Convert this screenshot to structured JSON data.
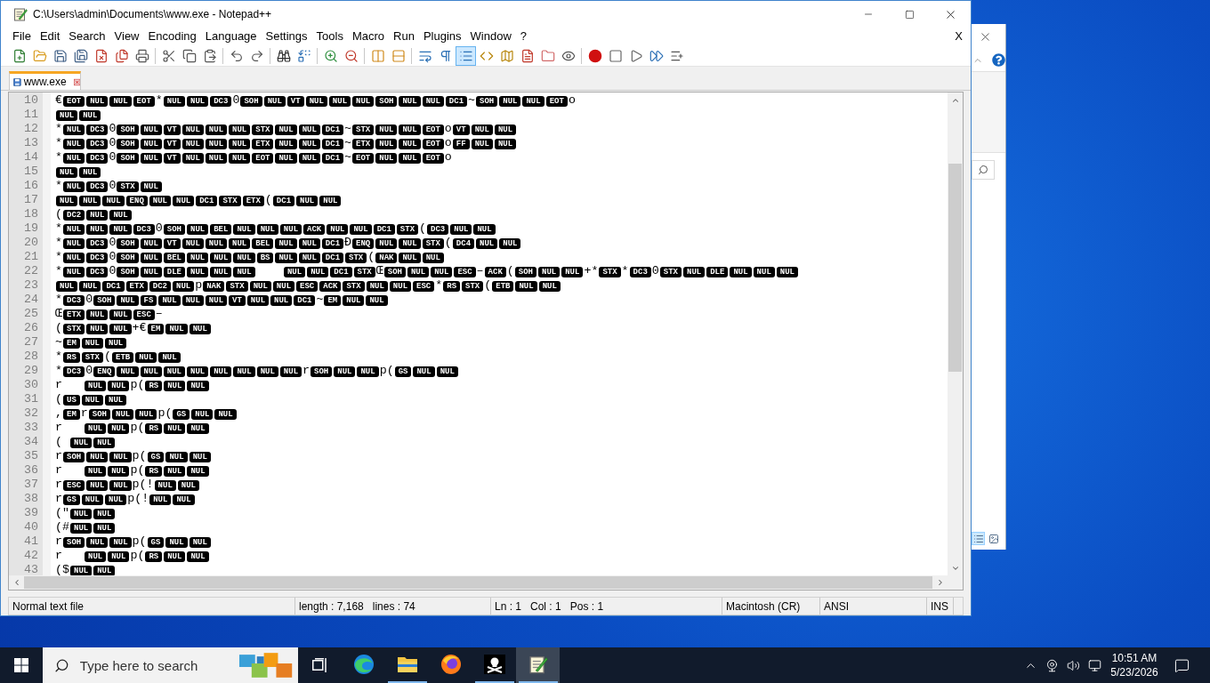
{
  "window": {
    "title": "C:\\Users\\admin\\Documents\\www.exe - Notepad++"
  },
  "menu": {
    "items": [
      "File",
      "Edit",
      "Search",
      "View",
      "Encoding",
      "Language",
      "Settings",
      "Tools",
      "Macro",
      "Run",
      "Plugins",
      "Window",
      "?"
    ],
    "close_label": "X"
  },
  "toolbar": [
    {
      "buttons": [
        {
          "on": false
        },
        {
          "on": false
        },
        {
          "on": false
        },
        {
          "on": false
        },
        {
          "on": false
        },
        {
          "on": false
        },
        {
          "on": false
        }
      ]
    },
    {
      "buttons": [
        {
          "on": false
        },
        {
          "on": false
        },
        {
          "on": false
        }
      ]
    },
    {
      "buttons": [
        {
          "on": false
        },
        {
          "on": false
        }
      ]
    },
    {
      "buttons": [
        {
          "on": false
        },
        {
          "on": false
        }
      ]
    },
    {
      "buttons": [
        {
          "on": false
        },
        {
          "on": false
        }
      ]
    },
    {
      "buttons": [
        {
          "on": false
        },
        {
          "on": false
        }
      ]
    },
    {
      "buttons": [
        {
          "on": false
        },
        {
          "on": false
        },
        {
          "on": true
        },
        {
          "on": false
        },
        {
          "on": false
        },
        {
          "on": false
        },
        {
          "on": false
        },
        {
          "on": false
        }
      ]
    },
    {
      "buttons": [
        {
          "on": false
        },
        {
          "on": false
        },
        {
          "on": false
        },
        {
          "on": false
        },
        {
          "on": false
        }
      ]
    }
  ],
  "tabs": [
    {
      "label": "www.exe",
      "selected": true
    }
  ],
  "editor": {
    "lines": [
      {
        "number": "10",
        "tokens": [
          {
            "kind": "text",
            "text": "€"
          },
          {
            "kind": "ctrl",
            "text": "EOT"
          },
          {
            "kind": "ctrl",
            "text": "NUL"
          },
          {
            "kind": "ctrl",
            "text": "NUL"
          },
          {
            "kind": "ctrl",
            "text": "EOT"
          },
          {
            "kind": "text",
            "text": "*"
          },
          {
            "kind": "ctrl",
            "text": "NUL"
          },
          {
            "kind": "ctrl",
            "text": "NUL"
          },
          {
            "kind": "ctrl",
            "text": "DC3"
          },
          {
            "kind": "text",
            "text": "0"
          },
          {
            "kind": "ctrl",
            "text": "SOH"
          },
          {
            "kind": "ctrl",
            "text": "NUL"
          },
          {
            "kind": "ctrl",
            "text": "VT"
          },
          {
            "kind": "ctrl",
            "text": "NUL"
          },
          {
            "kind": "ctrl",
            "text": "NUL"
          },
          {
            "kind": "ctrl",
            "text": "NUL"
          },
          {
            "kind": "ctrl",
            "text": "SOH"
          },
          {
            "kind": "ctrl",
            "text": "NUL"
          },
          {
            "kind": "ctrl",
            "text": "NUL"
          },
          {
            "kind": "ctrl",
            "text": "DC1"
          },
          {
            "kind": "text",
            "text": "~"
          },
          {
            "kind": "ctrl",
            "text": "SOH"
          },
          {
            "kind": "ctrl",
            "text": "NUL"
          },
          {
            "kind": "ctrl",
            "text": "NUL"
          },
          {
            "kind": "ctrl",
            "text": "EOT"
          },
          {
            "kind": "text",
            "text": "o"
          }
        ]
      },
      {
        "number": "11",
        "tokens": [
          {
            "kind": "ctrl",
            "text": "NUL"
          },
          {
            "kind": "ctrl",
            "text": "NUL"
          }
        ]
      },
      {
        "number": "12",
        "tokens": [
          {
            "kind": "text",
            "text": "*"
          },
          {
            "kind": "ctrl",
            "text": "NUL"
          },
          {
            "kind": "ctrl",
            "text": "DC3"
          },
          {
            "kind": "text",
            "text": "0"
          },
          {
            "kind": "ctrl",
            "text": "SOH"
          },
          {
            "kind": "ctrl",
            "text": "NUL"
          },
          {
            "kind": "ctrl",
            "text": "VT"
          },
          {
            "kind": "ctrl",
            "text": "NUL"
          },
          {
            "kind": "ctrl",
            "text": "NUL"
          },
          {
            "kind": "ctrl",
            "text": "NUL"
          },
          {
            "kind": "ctrl",
            "text": "STX"
          },
          {
            "kind": "ctrl",
            "text": "NUL"
          },
          {
            "kind": "ctrl",
            "text": "NUL"
          },
          {
            "kind": "ctrl",
            "text": "DC1"
          },
          {
            "kind": "text",
            "text": "~"
          },
          {
            "kind": "ctrl",
            "text": "STX"
          },
          {
            "kind": "ctrl",
            "text": "NUL"
          },
          {
            "kind": "ctrl",
            "text": "NUL"
          },
          {
            "kind": "ctrl",
            "text": "EOT"
          },
          {
            "kind": "text",
            "text": "o"
          },
          {
            "kind": "ctrl",
            "text": "VT"
          },
          {
            "kind": "ctrl",
            "text": "NUL"
          },
          {
            "kind": "ctrl",
            "text": "NUL"
          }
        ]
      },
      {
        "number": "13",
        "tokens": [
          {
            "kind": "text",
            "text": "*"
          },
          {
            "kind": "ctrl",
            "text": "NUL"
          },
          {
            "kind": "ctrl",
            "text": "DC3"
          },
          {
            "kind": "text",
            "text": "0"
          },
          {
            "kind": "ctrl",
            "text": "SOH"
          },
          {
            "kind": "ctrl",
            "text": "NUL"
          },
          {
            "kind": "ctrl",
            "text": "VT"
          },
          {
            "kind": "ctrl",
            "text": "NUL"
          },
          {
            "kind": "ctrl",
            "text": "NUL"
          },
          {
            "kind": "ctrl",
            "text": "NUL"
          },
          {
            "kind": "ctrl",
            "text": "ETX"
          },
          {
            "kind": "ctrl",
            "text": "NUL"
          },
          {
            "kind": "ctrl",
            "text": "NUL"
          },
          {
            "kind": "ctrl",
            "text": "DC1"
          },
          {
            "kind": "text",
            "text": "~"
          },
          {
            "kind": "ctrl",
            "text": "ETX"
          },
          {
            "kind": "ctrl",
            "text": "NUL"
          },
          {
            "kind": "ctrl",
            "text": "NUL"
          },
          {
            "kind": "ctrl",
            "text": "EOT"
          },
          {
            "kind": "text",
            "text": "o"
          },
          {
            "kind": "ctrl",
            "text": "FF"
          },
          {
            "kind": "ctrl",
            "text": "NUL"
          },
          {
            "kind": "ctrl",
            "text": "NUL"
          }
        ]
      },
      {
        "number": "14",
        "tokens": [
          {
            "kind": "text",
            "text": "*"
          },
          {
            "kind": "ctrl",
            "text": "NUL"
          },
          {
            "kind": "ctrl",
            "text": "DC3"
          },
          {
            "kind": "text",
            "text": "0"
          },
          {
            "kind": "ctrl",
            "text": "SOH"
          },
          {
            "kind": "ctrl",
            "text": "NUL"
          },
          {
            "kind": "ctrl",
            "text": "VT"
          },
          {
            "kind": "ctrl",
            "text": "NUL"
          },
          {
            "kind": "ctrl",
            "text": "NUL"
          },
          {
            "kind": "ctrl",
            "text": "NUL"
          },
          {
            "kind": "ctrl",
            "text": "EOT"
          },
          {
            "kind": "ctrl",
            "text": "NUL"
          },
          {
            "kind": "ctrl",
            "text": "NUL"
          },
          {
            "kind": "ctrl",
            "text": "DC1"
          },
          {
            "kind": "text",
            "text": "~"
          },
          {
            "kind": "ctrl",
            "text": "EOT"
          },
          {
            "kind": "ctrl",
            "text": "NUL"
          },
          {
            "kind": "ctrl",
            "text": "NUL"
          },
          {
            "kind": "ctrl",
            "text": "EOT"
          },
          {
            "kind": "text",
            "text": "o"
          }
        ]
      },
      {
        "number": "15",
        "tokens": [
          {
            "kind": "ctrl",
            "text": "NUL"
          },
          {
            "kind": "ctrl",
            "text": "NUL"
          }
        ]
      },
      {
        "number": "16",
        "tokens": [
          {
            "kind": "text",
            "text": "*"
          },
          {
            "kind": "ctrl",
            "text": "NUL"
          },
          {
            "kind": "ctrl",
            "text": "DC3"
          },
          {
            "kind": "text",
            "text": "0"
          },
          {
            "kind": "ctrl",
            "text": "STX"
          },
          {
            "kind": "ctrl",
            "text": "NUL"
          }
        ]
      },
      {
        "number": "17",
        "tokens": [
          {
            "kind": "ctrl",
            "text": "NUL"
          },
          {
            "kind": "ctrl",
            "text": "NUL"
          },
          {
            "kind": "ctrl",
            "text": "NUL"
          },
          {
            "kind": "ctrl",
            "text": "ENQ"
          },
          {
            "kind": "ctrl",
            "text": "NUL"
          },
          {
            "kind": "ctrl",
            "text": "NUL"
          },
          {
            "kind": "ctrl",
            "text": "DC1"
          },
          {
            "kind": "ctrl",
            "text": "STX"
          },
          {
            "kind": "ctrl",
            "text": "ETX"
          },
          {
            "kind": "text",
            "text": "("
          },
          {
            "kind": "ctrl",
            "text": "DC1"
          },
          {
            "kind": "ctrl",
            "text": "NUL"
          },
          {
            "kind": "ctrl",
            "text": "NUL"
          }
        ]
      },
      {
        "number": "18",
        "tokens": [
          {
            "kind": "text",
            "text": "("
          },
          {
            "kind": "ctrl",
            "text": "DC2"
          },
          {
            "kind": "ctrl",
            "text": "NUL"
          },
          {
            "kind": "ctrl",
            "text": "NUL"
          }
        ]
      },
      {
        "number": "19",
        "tokens": [
          {
            "kind": "text",
            "text": "*"
          },
          {
            "kind": "ctrl",
            "text": "NUL"
          },
          {
            "kind": "ctrl",
            "text": "NUL"
          },
          {
            "kind": "ctrl",
            "text": "NUL"
          },
          {
            "kind": "ctrl",
            "text": "DC3"
          },
          {
            "kind": "text",
            "text": "0"
          },
          {
            "kind": "ctrl",
            "text": "SOH"
          },
          {
            "kind": "ctrl",
            "text": "NUL"
          },
          {
            "kind": "ctrl",
            "text": "BEL"
          },
          {
            "kind": "ctrl",
            "text": "NUL"
          },
          {
            "kind": "ctrl",
            "text": "NUL"
          },
          {
            "kind": "ctrl",
            "text": "NUL"
          },
          {
            "kind": "ctrl",
            "text": "ACK"
          },
          {
            "kind": "ctrl",
            "text": "NUL"
          },
          {
            "kind": "ctrl",
            "text": "NUL"
          },
          {
            "kind": "ctrl",
            "text": "DC1"
          },
          {
            "kind": "ctrl",
            "text": "STX"
          },
          {
            "kind": "text",
            "text": "("
          },
          {
            "kind": "ctrl",
            "text": "DC3"
          },
          {
            "kind": "ctrl",
            "text": "NUL"
          },
          {
            "kind": "ctrl",
            "text": "NUL"
          }
        ]
      },
      {
        "number": "20",
        "tokens": [
          {
            "kind": "text",
            "text": "*"
          },
          {
            "kind": "ctrl",
            "text": "NUL"
          },
          {
            "kind": "ctrl",
            "text": "DC3"
          },
          {
            "kind": "text",
            "text": "0"
          },
          {
            "kind": "ctrl",
            "text": "SOH"
          },
          {
            "kind": "ctrl",
            "text": "NUL"
          },
          {
            "kind": "ctrl",
            "text": "VT"
          },
          {
            "kind": "ctrl",
            "text": "NUL"
          },
          {
            "kind": "ctrl",
            "text": "NUL"
          },
          {
            "kind": "ctrl",
            "text": "NUL"
          },
          {
            "kind": "ctrl",
            "text": "BEL"
          },
          {
            "kind": "ctrl",
            "text": "NUL"
          },
          {
            "kind": "ctrl",
            "text": "NUL"
          },
          {
            "kind": "ctrl",
            "text": "DC1"
          },
          {
            "kind": "text",
            "text": "Ð"
          },
          {
            "kind": "ctrl",
            "text": "ENQ"
          },
          {
            "kind": "ctrl",
            "text": "NUL"
          },
          {
            "kind": "ctrl",
            "text": "NUL"
          },
          {
            "kind": "ctrl",
            "text": "STX"
          },
          {
            "kind": "text",
            "text": "("
          },
          {
            "kind": "ctrl",
            "text": "DC4"
          },
          {
            "kind": "ctrl",
            "text": "NUL"
          },
          {
            "kind": "ctrl",
            "text": "NUL"
          }
        ]
      },
      {
        "number": "21",
        "tokens": [
          {
            "kind": "text",
            "text": "*"
          },
          {
            "kind": "ctrl",
            "text": "NUL"
          },
          {
            "kind": "ctrl",
            "text": "DC3"
          },
          {
            "kind": "text",
            "text": "0"
          },
          {
            "kind": "ctrl",
            "text": "SOH"
          },
          {
            "kind": "ctrl",
            "text": "NUL"
          },
          {
            "kind": "ctrl",
            "text": "BEL"
          },
          {
            "kind": "ctrl",
            "text": "NUL"
          },
          {
            "kind": "ctrl",
            "text": "NUL"
          },
          {
            "kind": "ctrl",
            "text": "NUL"
          },
          {
            "kind": "ctrl",
            "text": "BS"
          },
          {
            "kind": "ctrl",
            "text": "NUL"
          },
          {
            "kind": "ctrl",
            "text": "NUL"
          },
          {
            "kind": "ctrl",
            "text": "DC1"
          },
          {
            "kind": "ctrl",
            "text": "STX"
          },
          {
            "kind": "text",
            "text": "("
          },
          {
            "kind": "ctrl",
            "text": "NAK"
          },
          {
            "kind": "ctrl",
            "text": "NUL"
          },
          {
            "kind": "ctrl",
            "text": "NUL"
          }
        ]
      },
      {
        "number": "22",
        "tokens": [
          {
            "kind": "text",
            "text": "*"
          },
          {
            "kind": "ctrl",
            "text": "NUL"
          },
          {
            "kind": "ctrl",
            "text": "DC3"
          },
          {
            "kind": "text",
            "text": "0"
          },
          {
            "kind": "ctrl",
            "text": "SOH"
          },
          {
            "kind": "ctrl",
            "text": "NUL"
          },
          {
            "kind": "ctrl",
            "text": "DLE"
          },
          {
            "kind": "ctrl",
            "text": "NUL"
          },
          {
            "kind": "ctrl",
            "text": "NUL"
          },
          {
            "kind": "ctrl",
            "text": "NUL"
          },
          {
            "kind": "tab"
          },
          {
            "kind": "ctrl",
            "text": "NUL"
          },
          {
            "kind": "ctrl",
            "text": "NUL"
          },
          {
            "kind": "ctrl",
            "text": "DC1"
          },
          {
            "kind": "ctrl",
            "text": "STX"
          },
          {
            "kind": "text",
            "text": "Œ"
          },
          {
            "kind": "ctrl",
            "text": "SOH"
          },
          {
            "kind": "ctrl",
            "text": "NUL"
          },
          {
            "kind": "ctrl",
            "text": "NUL"
          },
          {
            "kind": "ctrl",
            "text": "ESC"
          },
          {
            "kind": "text",
            "text": "–"
          },
          {
            "kind": "ctrl",
            "text": "ACK"
          },
          {
            "kind": "text",
            "text": "("
          },
          {
            "kind": "ctrl",
            "text": "SOH"
          },
          {
            "kind": "ctrl",
            "text": "NUL"
          },
          {
            "kind": "ctrl",
            "text": "NUL"
          },
          {
            "kind": "text",
            "text": "+*"
          },
          {
            "kind": "ctrl",
            "text": "STX"
          },
          {
            "kind": "text",
            "text": "*"
          },
          {
            "kind": "ctrl",
            "text": "DC3"
          },
          {
            "kind": "text",
            "text": "0"
          },
          {
            "kind": "ctrl",
            "text": "STX"
          },
          {
            "kind": "ctrl",
            "text": "NUL"
          },
          {
            "kind": "ctrl",
            "text": "DLE"
          },
          {
            "kind": "ctrl",
            "text": "NUL"
          },
          {
            "kind": "ctrl",
            "text": "NUL"
          },
          {
            "kind": "ctrl",
            "text": "NUL"
          }
        ]
      },
      {
        "number": "23",
        "tokens": [
          {
            "kind": "ctrl",
            "text": "NUL"
          },
          {
            "kind": "ctrl",
            "text": "NUL"
          },
          {
            "kind": "ctrl",
            "text": "DC1"
          },
          {
            "kind": "ctrl",
            "text": "ETX"
          },
          {
            "kind": "ctrl",
            "text": "DC2"
          },
          {
            "kind": "ctrl",
            "text": "NUL"
          },
          {
            "kind": "text",
            "text": "p"
          },
          {
            "kind": "ctrl",
            "text": "NAK"
          },
          {
            "kind": "ctrl",
            "text": "STX"
          },
          {
            "kind": "ctrl",
            "text": "NUL"
          },
          {
            "kind": "ctrl",
            "text": "NUL"
          },
          {
            "kind": "ctrl",
            "text": "ESC"
          },
          {
            "kind": "ctrl",
            "text": "ACK"
          },
          {
            "kind": "ctrl",
            "text": "STX"
          },
          {
            "kind": "ctrl",
            "text": "NUL"
          },
          {
            "kind": "ctrl",
            "text": "NUL"
          },
          {
            "kind": "ctrl",
            "text": "ESC"
          },
          {
            "kind": "text",
            "text": "*"
          },
          {
            "kind": "ctrl",
            "text": "RS"
          },
          {
            "kind": "ctrl",
            "text": "STX"
          },
          {
            "kind": "text",
            "text": "("
          },
          {
            "kind": "ctrl",
            "text": "ETB"
          },
          {
            "kind": "ctrl",
            "text": "NUL"
          },
          {
            "kind": "ctrl",
            "text": "NUL"
          }
        ]
      },
      {
        "number": "24",
        "tokens": [
          {
            "kind": "text",
            "text": "*"
          },
          {
            "kind": "ctrl",
            "text": "DC3"
          },
          {
            "kind": "text",
            "text": "0"
          },
          {
            "kind": "ctrl",
            "text": "SOH"
          },
          {
            "kind": "ctrl",
            "text": "NUL"
          },
          {
            "kind": "ctrl",
            "text": "FS"
          },
          {
            "kind": "ctrl",
            "text": "NUL"
          },
          {
            "kind": "ctrl",
            "text": "NUL"
          },
          {
            "kind": "ctrl",
            "text": "NUL"
          },
          {
            "kind": "ctrl",
            "text": "VT"
          },
          {
            "kind": "ctrl",
            "text": "NUL"
          },
          {
            "kind": "ctrl",
            "text": "NUL"
          },
          {
            "kind": "ctrl",
            "text": "DC1"
          },
          {
            "kind": "text",
            "text": "~"
          },
          {
            "kind": "ctrl",
            "text": "EM"
          },
          {
            "kind": "ctrl",
            "text": "NUL"
          },
          {
            "kind": "ctrl",
            "text": "NUL"
          }
        ]
      },
      {
        "number": "25",
        "tokens": [
          {
            "kind": "text",
            "text": "Œ"
          },
          {
            "kind": "ctrl",
            "text": "ETX"
          },
          {
            "kind": "ctrl",
            "text": "NUL"
          },
          {
            "kind": "ctrl",
            "text": "NUL"
          },
          {
            "kind": "ctrl",
            "text": "ESC"
          },
          {
            "kind": "text",
            "text": "–"
          }
        ]
      },
      {
        "number": "26",
        "tokens": [
          {
            "kind": "text",
            "text": "("
          },
          {
            "kind": "ctrl",
            "text": "STX"
          },
          {
            "kind": "ctrl",
            "text": "NUL"
          },
          {
            "kind": "ctrl",
            "text": "NUL"
          },
          {
            "kind": "text",
            "text": "+€"
          },
          {
            "kind": "ctrl",
            "text": "EM"
          },
          {
            "kind": "ctrl",
            "text": "NUL"
          },
          {
            "kind": "ctrl",
            "text": "NUL"
          }
        ]
      },
      {
        "number": "27",
        "tokens": [
          {
            "kind": "text",
            "text": "~"
          },
          {
            "kind": "ctrl",
            "text": "EM"
          },
          {
            "kind": "ctrl",
            "text": "NUL"
          },
          {
            "kind": "ctrl",
            "text": "NUL"
          }
        ]
      },
      {
        "number": "28",
        "tokens": [
          {
            "kind": "text",
            "text": "*"
          },
          {
            "kind": "ctrl",
            "text": "RS"
          },
          {
            "kind": "ctrl",
            "text": "STX"
          },
          {
            "kind": "text",
            "text": "("
          },
          {
            "kind": "ctrl",
            "text": "ETB"
          },
          {
            "kind": "ctrl",
            "text": "NUL"
          },
          {
            "kind": "ctrl",
            "text": "NUL"
          }
        ]
      },
      {
        "number": "29",
        "tokens": [
          {
            "kind": "text",
            "text": "*"
          },
          {
            "kind": "ctrl",
            "text": "DC3"
          },
          {
            "kind": "text",
            "text": "0"
          },
          {
            "kind": "ctrl",
            "text": "ENQ"
          },
          {
            "kind": "ctrl",
            "text": "NUL"
          },
          {
            "kind": "ctrl",
            "text": "NUL"
          },
          {
            "kind": "ctrl",
            "text": "NUL"
          },
          {
            "kind": "ctrl",
            "text": "NUL"
          },
          {
            "kind": "ctrl",
            "text": "NUL"
          },
          {
            "kind": "ctrl",
            "text": "NUL"
          },
          {
            "kind": "ctrl",
            "text": "NUL"
          },
          {
            "kind": "ctrl",
            "text": "NUL"
          },
          {
            "kind": "text",
            "text": "r"
          },
          {
            "kind": "ctrl",
            "text": "SOH"
          },
          {
            "kind": "ctrl",
            "text": "NUL"
          },
          {
            "kind": "ctrl",
            "text": "NUL"
          },
          {
            "kind": "text",
            "text": "p("
          },
          {
            "kind": "ctrl",
            "text": "GS"
          },
          {
            "kind": "ctrl",
            "text": "NUL"
          },
          {
            "kind": "ctrl",
            "text": "NUL"
          }
        ]
      },
      {
        "number": "30",
        "tokens": [
          {
            "kind": "text",
            "text": "r"
          },
          {
            "kind": "tab"
          },
          {
            "kind": "ctrl",
            "text": "NUL"
          },
          {
            "kind": "ctrl",
            "text": "NUL"
          },
          {
            "kind": "text",
            "text": "p("
          },
          {
            "kind": "ctrl",
            "text": "RS"
          },
          {
            "kind": "ctrl",
            "text": "NUL"
          },
          {
            "kind": "ctrl",
            "text": "NUL"
          }
        ]
      },
      {
        "number": "31",
        "tokens": [
          {
            "kind": "text",
            "text": "("
          },
          {
            "kind": "ctrl",
            "text": "US"
          },
          {
            "kind": "ctrl",
            "text": "NUL"
          },
          {
            "kind": "ctrl",
            "text": "NUL"
          }
        ]
      },
      {
        "number": "32",
        "tokens": [
          {
            "kind": "text",
            "text": ","
          },
          {
            "kind": "ctrl",
            "text": "EM"
          },
          {
            "kind": "text",
            "text": "r"
          },
          {
            "kind": "ctrl",
            "text": "SOH"
          },
          {
            "kind": "ctrl",
            "text": "NUL"
          },
          {
            "kind": "ctrl",
            "text": "NUL"
          },
          {
            "kind": "text",
            "text": "p("
          },
          {
            "kind": "ctrl",
            "text": "GS"
          },
          {
            "kind": "ctrl",
            "text": "NUL"
          },
          {
            "kind": "ctrl",
            "text": "NUL"
          }
        ]
      },
      {
        "number": "33",
        "tokens": [
          {
            "kind": "text",
            "text": "r"
          },
          {
            "kind": "tab"
          },
          {
            "kind": "ctrl",
            "text": "NUL"
          },
          {
            "kind": "ctrl",
            "text": "NUL"
          },
          {
            "kind": "text",
            "text": "p("
          },
          {
            "kind": "ctrl",
            "text": "RS"
          },
          {
            "kind": "ctrl",
            "text": "NUL"
          },
          {
            "kind": "ctrl",
            "text": "NUL"
          }
        ]
      },
      {
        "number": "34",
        "tokens": [
          {
            "kind": "text",
            "text": "("
          },
          {
            "kind": "space"
          },
          {
            "kind": "ctrl",
            "text": "NUL"
          },
          {
            "kind": "ctrl",
            "text": "NUL"
          }
        ]
      },
      {
        "number": "35",
        "tokens": [
          {
            "kind": "text",
            "text": "r"
          },
          {
            "kind": "ctrl",
            "text": "SOH"
          },
          {
            "kind": "ctrl",
            "text": "NUL"
          },
          {
            "kind": "ctrl",
            "text": "NUL"
          },
          {
            "kind": "text",
            "text": "p("
          },
          {
            "kind": "ctrl",
            "text": "GS"
          },
          {
            "kind": "ctrl",
            "text": "NUL"
          },
          {
            "kind": "ctrl",
            "text": "NUL"
          }
        ]
      },
      {
        "number": "36",
        "tokens": [
          {
            "kind": "text",
            "text": "r"
          },
          {
            "kind": "tab"
          },
          {
            "kind": "ctrl",
            "text": "NUL"
          },
          {
            "kind": "ctrl",
            "text": "NUL"
          },
          {
            "kind": "text",
            "text": "p("
          },
          {
            "kind": "ctrl",
            "text": "RS"
          },
          {
            "kind": "ctrl",
            "text": "NUL"
          },
          {
            "kind": "ctrl",
            "text": "NUL"
          }
        ]
      },
      {
        "number": "37",
        "tokens": [
          {
            "kind": "text",
            "text": "r"
          },
          {
            "kind": "ctrl",
            "text": "ESC"
          },
          {
            "kind": "ctrl",
            "text": "NUL"
          },
          {
            "kind": "ctrl",
            "text": "NUL"
          },
          {
            "kind": "text",
            "text": "p(!"
          },
          {
            "kind": "ctrl",
            "text": "NUL"
          },
          {
            "kind": "ctrl",
            "text": "NUL"
          }
        ]
      },
      {
        "number": "38",
        "tokens": [
          {
            "kind": "text",
            "text": "r"
          },
          {
            "kind": "ctrl",
            "text": "GS"
          },
          {
            "kind": "ctrl",
            "text": "NUL"
          },
          {
            "kind": "ctrl",
            "text": "NUL"
          },
          {
            "kind": "text",
            "text": "p(!"
          },
          {
            "kind": "ctrl",
            "text": "NUL"
          },
          {
            "kind": "ctrl",
            "text": "NUL"
          }
        ]
      },
      {
        "number": "39",
        "tokens": [
          {
            "kind": "text",
            "text": "(\""
          },
          {
            "kind": "ctrl",
            "text": "NUL"
          },
          {
            "kind": "ctrl",
            "text": "NUL"
          }
        ]
      },
      {
        "number": "40",
        "tokens": [
          {
            "kind": "text",
            "text": "(#"
          },
          {
            "kind": "ctrl",
            "text": "NUL"
          },
          {
            "kind": "ctrl",
            "text": "NUL"
          }
        ]
      },
      {
        "number": "41",
        "tokens": [
          {
            "kind": "text",
            "text": "r"
          },
          {
            "kind": "ctrl",
            "text": "SOH"
          },
          {
            "kind": "ctrl",
            "text": "NUL"
          },
          {
            "kind": "ctrl",
            "text": "NUL"
          },
          {
            "kind": "text",
            "text": "p("
          },
          {
            "kind": "ctrl",
            "text": "GS"
          },
          {
            "kind": "ctrl",
            "text": "NUL"
          },
          {
            "kind": "ctrl",
            "text": "NUL"
          }
        ]
      },
      {
        "number": "42",
        "tokens": [
          {
            "kind": "text",
            "text": "r"
          },
          {
            "kind": "tab"
          },
          {
            "kind": "ctrl",
            "text": "NUL"
          },
          {
            "kind": "ctrl",
            "text": "NUL"
          },
          {
            "kind": "text",
            "text": "p("
          },
          {
            "kind": "ctrl",
            "text": "RS"
          },
          {
            "kind": "ctrl",
            "text": "NUL"
          },
          {
            "kind": "ctrl",
            "text": "NUL"
          }
        ]
      },
      {
        "number": "43",
        "tokens": [
          {
            "kind": "text",
            "text": "($"
          },
          {
            "kind": "ctrl",
            "text": "NUL"
          },
          {
            "kind": "ctrl",
            "text": "NUL"
          }
        ]
      }
    ]
  },
  "status_bar": [
    {
      "texts": [
        "Normal text file"
      ]
    },
    {
      "texts": [
        "length : 7,168",
        "lines : 74"
      ]
    },
    {
      "texts": [
        "Ln : 1",
        "Col : 1",
        "Pos : 1"
      ]
    },
    {
      "texts": [
        "Macintosh (CR)"
      ]
    },
    {
      "texts": [
        "ANSI"
      ]
    },
    {
      "texts": [
        "INS"
      ]
    }
  ],
  "background_window": {
    "view_buttons": [
      {
        "selected": true
      },
      {
        "selected": false
      }
    ]
  },
  "taskbar": {
    "search": {
      "placeholder": "Type here to search"
    },
    "apps": [
      {
        "running": false,
        "selected": false
      },
      {
        "running": true,
        "selected": false
      },
      {
        "running": false,
        "selected": false
      },
      {
        "running": true,
        "selected": false
      },
      {
        "running": true,
        "selected": true
      }
    ],
    "clock": {
      "time": "10:51 AM",
      "date": "5/23/2026"
    }
  }
}
